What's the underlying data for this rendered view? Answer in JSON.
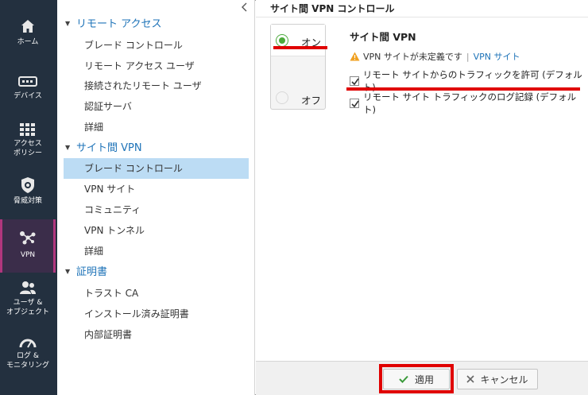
{
  "nav": {
    "items": [
      {
        "label": "ホーム",
        "icon": "home-icon"
      },
      {
        "label": "デバイス",
        "icon": "device-icon"
      },
      {
        "label1": "アクセス",
        "label2": "ポリシー",
        "icon": "access-policy-icon"
      },
      {
        "label": "脅威対策",
        "icon": "threat-prevention-icon"
      },
      {
        "label": "VPN",
        "icon": "vpn-icon",
        "active": true
      },
      {
        "label1": "ユーザ &",
        "label2": "オブジェクト",
        "icon": "users-objects-icon"
      },
      {
        "label1": "ログ &",
        "label2": "モニタリング",
        "icon": "logs-monitoring-icon"
      }
    ]
  },
  "tree": {
    "sections": [
      {
        "title": "リモート アクセス",
        "items": [
          "ブレード コントロール",
          "リモート アクセス ユーザ",
          "接続されたリモート ユーザ",
          "認証サーバ",
          "詳細"
        ]
      },
      {
        "title": "サイト間 VPN",
        "items": [
          "ブレード コントロール",
          "VPN サイト",
          "コミュニティ",
          "VPN トンネル",
          "詳細"
        ]
      },
      {
        "title": "証明書",
        "items": [
          "トラスト CA",
          "インストール済み証明書",
          "内部証明書"
        ]
      }
    ]
  },
  "main": {
    "title": "サイト間 VPN コントロール",
    "on_label": "オン",
    "off_label": "オフ",
    "settings_title": "サイト間 VPN",
    "warning_text": "VPN サイトが未定義です",
    "warning_sep": "|",
    "warning_link": "VPN サイト",
    "check1": "リモート サイトからのトラフィックを許可 (デフォルト)",
    "check2": "リモート サイト トラフィックのログ記録 (デフォルト)"
  },
  "buttons": {
    "apply": "適用",
    "cancel": "キャンセル"
  },
  "colors": {
    "nav_bg": "#23303f",
    "nav_active_accent": "#b1367d",
    "link_blue": "#1e73b8",
    "selected_row": "#bcdcf4",
    "highlight_red": "#e00000",
    "on_green": "#4caa3c"
  }
}
